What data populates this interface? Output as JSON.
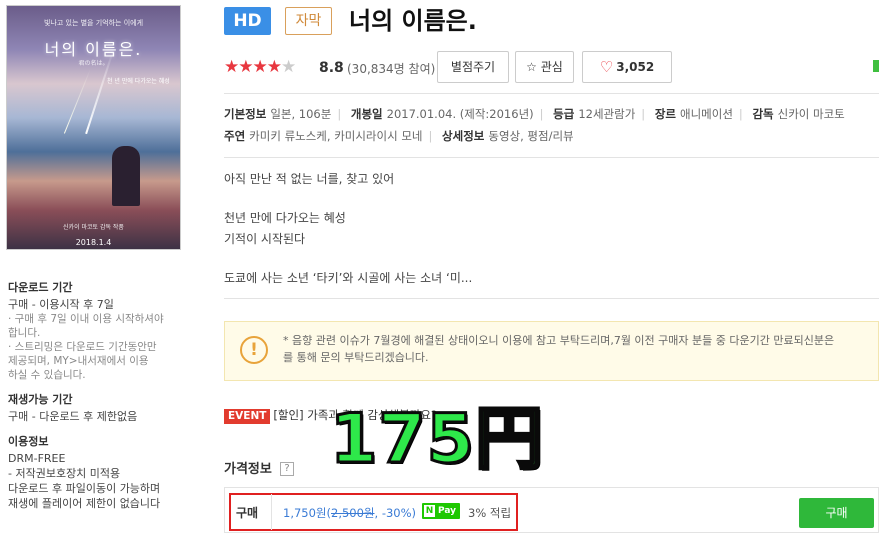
{
  "poster": {
    "top_text": "빛나고 있는 별을 기억하는 이에게",
    "title": "너의 이름은.",
    "sub_text": "君の名は。",
    "mid_text": "천 년 만에 다가오는 혜성",
    "bottom_text": "신카이 마코토 감독 작품",
    "date": "2018.1.4"
  },
  "sidebar": {
    "download": {
      "heading": "다운로드 기간",
      "text": "구매 - 이용시작 후 7일",
      "notes": [
        "· 구매 후 7일 이내 이용 시작하셔야",
        "  합니다.",
        "· 스트리밍은 다운로드 기간동안만",
        "  제공되며, MY>내서재에서 이용",
        "  하실 수 있습니다."
      ]
    },
    "replay": {
      "heading": "재생가능 기간",
      "text": "구매 - 다운로드 후 제한없음"
    },
    "usage": {
      "heading": "이용정보",
      "lines": [
        "DRM-FREE",
        "- 저작권보호장치 미적용",
        "다운로드 후 파일이동이 가능하며",
        "재생에 플레이어 제한이 없습니다"
      ]
    }
  },
  "header": {
    "badge_hd": "HD",
    "badge_sub": "자막",
    "title": "너의 이름은."
  },
  "rating": {
    "stars_full": "★★★★",
    "stars_half": "★",
    "score": "8.8",
    "votes": "(30,834명 참여)",
    "rate_button": "별점주기",
    "fav_icon": "☆",
    "fav_button": "관심",
    "like_icon": "heart-icon",
    "like_count": "3,052"
  },
  "meta": {
    "row1": {
      "basic_label": "기본정보",
      "basic_value": "일본, 106분",
      "release_label": "개봉일",
      "release_value": "2017.01.04. (제작:2016년)",
      "grade_label": "등급",
      "grade_value": "12세관람가",
      "genre_label": "장르",
      "genre_value": "애니메이션",
      "director_label": "감독",
      "director_value": "신카이 마코토"
    },
    "row2": {
      "cast_label": "주연",
      "cast_value": "카미키 류노스케, 카미시라이시 모네",
      "detail_label": "상세정보",
      "detail_value": "동영상, 평점/리뷰"
    }
  },
  "synopsis": {
    "line1": "아직 만난 적 없는 너를, 찾고 있어",
    "line2": "천년 만에 다가오는 혜성",
    "line3": "기적이 시작된다",
    "line4": "도쿄에 사는 소년 ‘타키’와 시골에 사는 소녀 ‘미..."
  },
  "notice": {
    "icon": "!",
    "line1": "* 음향 관련 이슈가 7월경에 해결된 상태이오니 이용에 참고 부탁드리며,7월 이전 구매자 분들 중 다운기간 만료되신분은",
    "line2": "를 통해 문의 부탁드리겠습니다."
  },
  "event": {
    "badge": "EVENT",
    "text": "[할인] 가족과 함께 감상해볼까요?"
  },
  "overlay": {
    "price_text": "175円"
  },
  "price": {
    "heading": "가격정보",
    "help_icon": "?",
    "buy_label": "구매",
    "sale_price": "1,750원(",
    "orig_price": "2,500원",
    "discount": ", -30%)",
    "npay_n": "N",
    "npay_text": "Pay",
    "point": "3% 적립",
    "buy_button": "구매"
  },
  "colors": {
    "hd_badge": "#3a8fe6",
    "star": "#e8373f",
    "price_link": "#3a7bd5",
    "buy_button": "#2fb83a",
    "overlay_text": "#2ee84a",
    "highlight_box": "#e02020"
  }
}
